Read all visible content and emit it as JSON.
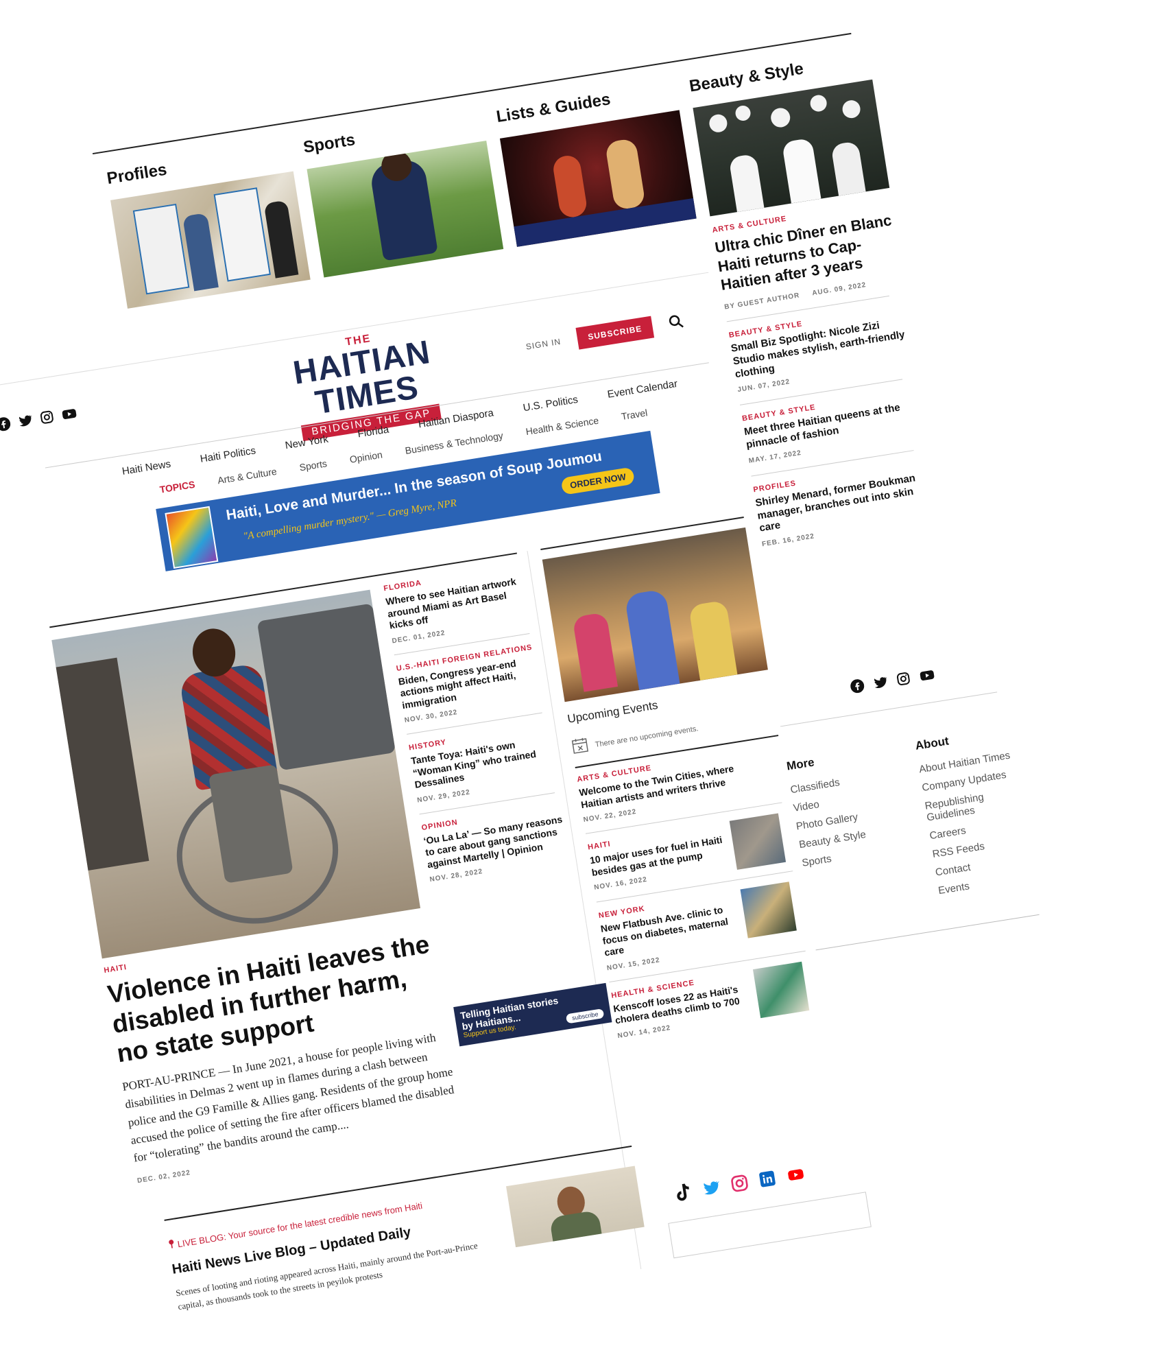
{
  "categories": [
    {
      "label": "Profiles"
    },
    {
      "label": "Sports"
    },
    {
      "label": "Lists & Guides"
    },
    {
      "label": "Beauty & Style"
    }
  ],
  "header": {
    "logo_the": "THE",
    "logo_name": "HAITIAN TIMES",
    "tagline": "BRIDGING THE GAP",
    "sign_in": "SIGN IN",
    "subscribe": "SUBSCRIBE"
  },
  "nav": {
    "items": [
      "Haiti News",
      "Haiti Politics",
      "New York",
      "Florida",
      "Haitian Diaspora",
      "U.S. Politics",
      "Event Calendar"
    ],
    "topics_label": "TOPICS",
    "topics": [
      "Arts & Culture",
      "Sports",
      "Opinion",
      "Business & Technology",
      "Health & Science",
      "Travel"
    ]
  },
  "ad_banner": {
    "title": "Haiti, Love and Murder... In the season of Soup Joumou",
    "quote": "\"A compelling murder mystery.\" — Greg Myre, NPR",
    "cta": "ORDER NOW"
  },
  "right_rail": {
    "feature": {
      "kicker": "ARTS & CULTURE",
      "headline": "Ultra chic Dîner en Blanc Haiti returns to Cap-Haitien after 3 years",
      "author": "BY GUEST AUTHOR",
      "date": "AUG. 09, 2022"
    },
    "items": [
      {
        "kicker": "BEAUTY & STYLE",
        "headline": "Small Biz Spotlight: Nicole Zizi Studio makes stylish, earth-friendly clothing",
        "date": "JUN. 07, 2022"
      },
      {
        "kicker": "BEAUTY & STYLE",
        "headline": "Meet three Haitian queens at the pinnacle of fashion",
        "date": "MAY. 17, 2022"
      },
      {
        "kicker": "PROFILES",
        "headline": "Shirley Menard, former Boukman manager, branches out into skin care",
        "date": "FEB. 16, 2022"
      }
    ]
  },
  "lead": {
    "kicker": "HAITI",
    "headline": "Violence in Haiti leaves the disabled in further harm, no state support",
    "excerpt": "PORT-AU-PRINCE — In June 2021, a house for people living with disabilities in Delmas 2 went up in flames during a clash between police and the G9 Famille & Allies gang. Residents of the group home accused the police of setting the fire after officers blamed the disabled for “tolerating” the bandits around the camp....",
    "date": "DEC. 02, 2022"
  },
  "middle_list": [
    {
      "kicker": "FLORIDA",
      "headline": "Where to see Haitian artwork around Miami as Art Basel kicks off",
      "date": "DEC. 01, 2022"
    },
    {
      "kicker": "U.S.-HAITI FOREIGN RELATIONS",
      "headline": "Biden, Congress year-end actions might affect Haiti, immigration",
      "date": "NOV. 30, 2022"
    },
    {
      "kicker": "HISTORY",
      "headline": "Tante Toya: Haiti's own “Woman King” who trained Dessalines",
      "date": "NOV. 29, 2022"
    },
    {
      "kicker": "OPINION",
      "headline": "‘Ou La La’ — So many reasons to care about gang sanctions against Martelly | Opinion",
      "date": "NOV. 28, 2022"
    }
  ],
  "promo": {
    "line1": "Telling Haitian stories",
    "line2": "by Haitians...",
    "line3": "Support us today.",
    "button": "subscribe"
  },
  "events": {
    "title": "Upcoming Events",
    "empty": "There are no upcoming events."
  },
  "column_list": [
    {
      "kicker": "ARTS & CULTURE",
      "headline": "Welcome to the Twin Cities, where Haitian artists and writers thrive",
      "date": "NOV. 22, 2022"
    },
    {
      "kicker": "HAITI",
      "headline": "10 major uses for fuel in Haiti besides gas at the pump",
      "date": "NOV. 16, 2022"
    },
    {
      "kicker": "NEW YORK",
      "headline": "New Flatbush Ave. clinic to focus on diabetes, maternal care",
      "date": "NOV. 15, 2022"
    },
    {
      "kicker": "HEALTH & SCIENCE",
      "headline": "Kenscoff loses 22 as Haiti's cholera deaths climb to 700",
      "date": "NOV. 14, 2022"
    }
  ],
  "live_blog": {
    "label": "LIVE BLOG: Your source for the latest credible news from Haiti",
    "title": "Haiti News Live Blog – Updated Daily",
    "excerpt": "Scenes of looting and rioting appeared across Haiti, mainly around the Port-au-Prince capital, as thousands took to the streets in peyilok protests"
  },
  "footer": {
    "more_title": "More",
    "more_links": [
      "Classifieds",
      "Video",
      "Photo Gallery",
      "Beauty & Style",
      "Sports"
    ],
    "about_title": "About",
    "about_links": [
      "About Haitian Times",
      "Company Updates",
      "Republishing Guidelines",
      "Careers",
      "RSS Feeds",
      "Contact",
      "Events"
    ]
  },
  "social_icons": [
    "facebook-icon",
    "twitter-icon",
    "instagram-icon",
    "youtube-icon"
  ],
  "social_color_icons": [
    "tiktok-icon",
    "twitter-icon",
    "instagram-icon",
    "linkedin-icon",
    "youtube-icon"
  ],
  "colors": {
    "brand_red": "#c8203a",
    "brand_navy": "#1d2a52",
    "ad_blue": "#2a63b5",
    "ad_yellow": "#f5c518"
  }
}
